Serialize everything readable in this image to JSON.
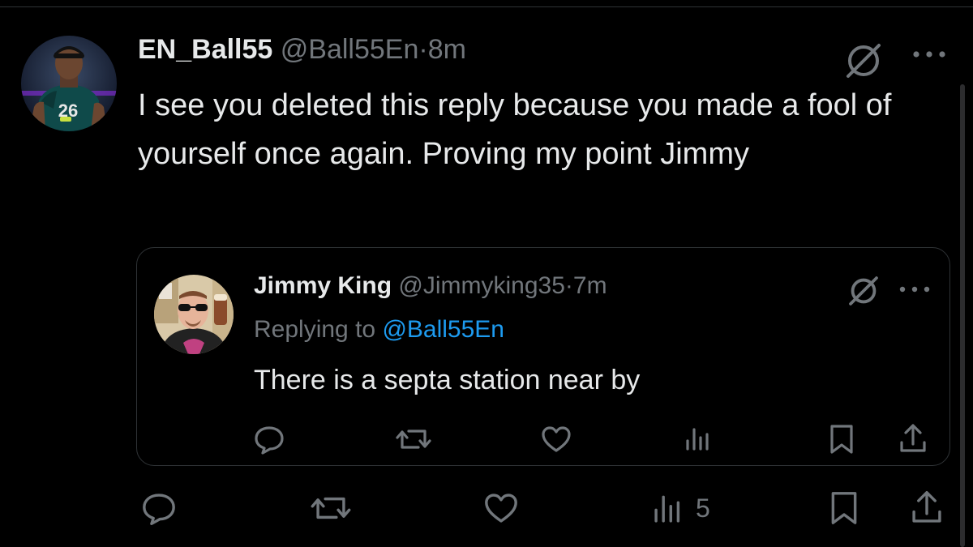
{
  "main_tweet": {
    "display_name": "EN_Ball55",
    "handle": "@Ball55En",
    "separator": "·",
    "time": "8m",
    "text": "I see you deleted this reply because you made a fool of yourself once again. Proving my point Jimmy",
    "actions": {
      "reply_icon": "reply-icon",
      "repost_icon": "repost-icon",
      "like_icon": "like-icon",
      "views_icon": "views-icon",
      "views_count": "5",
      "bookmark_icon": "bookmark-icon",
      "share_icon": "share-icon"
    }
  },
  "quoted_tweet": {
    "display_name": "Jimmy King",
    "handle": "@Jimmyking35",
    "separator": "·",
    "time": "7m",
    "replying_prefix": "Replying to",
    "replying_to": "@Ball55En",
    "text": "There is a septa station near by"
  },
  "colors": {
    "background": "#000000",
    "primary_text": "#e7e9ea",
    "secondary_text": "#71767b",
    "link": "#1d9bf0",
    "border": "#2f3336"
  }
}
